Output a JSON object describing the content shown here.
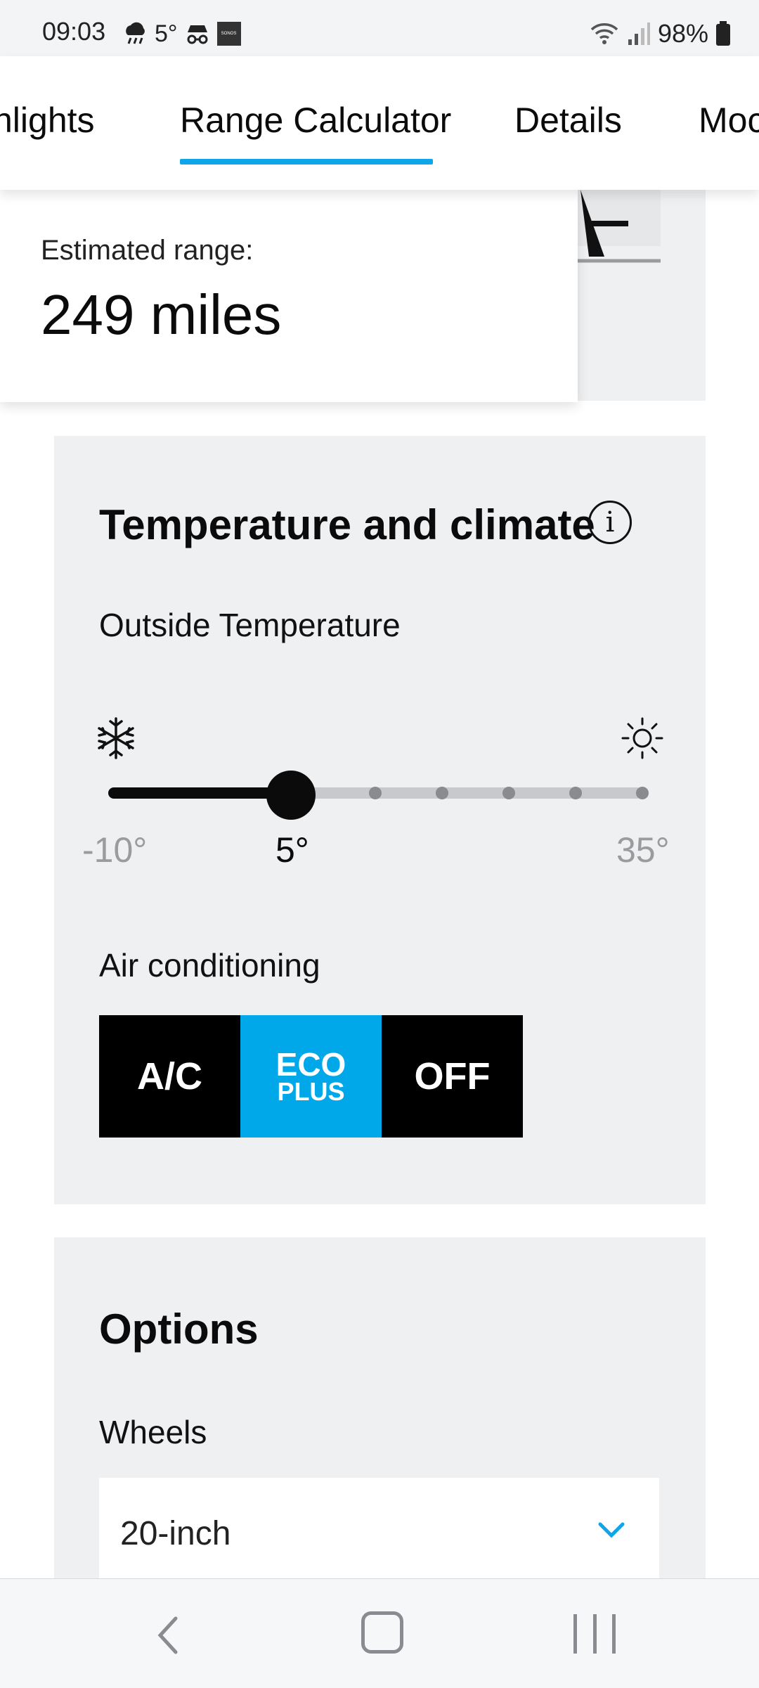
{
  "status_bar": {
    "time": "09:03",
    "weather_temp": "5°",
    "battery": "98%"
  },
  "tabs": [
    {
      "label": "hlights"
    },
    {
      "label": "Range Calculator",
      "active": true
    },
    {
      "label": "Details"
    },
    {
      "label": "Moc"
    }
  ],
  "range": {
    "label": "Estimated range:",
    "value": "249 miles"
  },
  "temperature_section": {
    "title": "Temperature and climate",
    "outside_label": "Outside Temperature",
    "slider": {
      "min_label": "-10°",
      "current_label": "5°",
      "max_label": "35°",
      "min": -10,
      "max": 35,
      "value": 5,
      "steps": 9
    },
    "air_label": "Air conditioning",
    "ac_buttons": {
      "ac": "A/C",
      "eco_top": "ECO",
      "eco_bottom": "PLUS",
      "off": "OFF",
      "selected": "ECO PLUS"
    }
  },
  "options_section": {
    "title": "Options",
    "wheels_label": "Wheels",
    "wheels_value": "20-inch"
  },
  "colors": {
    "accent": "#0ea5e9",
    "eco_blue": "#00a8ea",
    "panel_bg": "#eff0f2"
  },
  "icons": {
    "weather": "rain-cloud-icon",
    "incognito": "incognito-icon",
    "snow": "snowflake-icon",
    "sun": "sun-icon",
    "info": "info-icon",
    "chevron": "chevron-down-icon"
  }
}
